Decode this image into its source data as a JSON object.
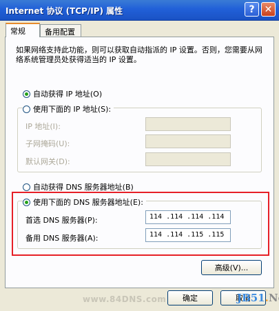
{
  "window": {
    "title": "Internet 协议 (TCP/IP) 属性",
    "help_glyph": "?",
    "close_glyph": "✕"
  },
  "tabs": [
    {
      "label": "常规",
      "active": true
    },
    {
      "label": "备用配置",
      "active": false
    }
  ],
  "intro": "如果网络支持此功能，则可以获取自动指派的 IP 设置。否则，您需要从网络系统管理员处获得适当的 IP 设置。",
  "ip": {
    "auto_label": "自动获得 IP 地址(O)",
    "manual_label": "使用下面的 IP 地址(S):",
    "fields": [
      {
        "label": "IP 地址(I):",
        "value": ""
      },
      {
        "label": "子网掩码(U):",
        "value": ""
      },
      {
        "label": "默认网关(D):",
        "value": ""
      }
    ]
  },
  "dns": {
    "auto_label": "自动获得 DNS 服务器地址(B)",
    "manual_label": "使用下面的 DNS 服务器地址(E):",
    "preferred_label": "首选 DNS 服务器(P):",
    "preferred_value": "114 .114 .114 .114",
    "alternate_label": "备用 DNS 服务器(A):",
    "alternate_value": "114 .114 .115 .115"
  },
  "buttons": {
    "advanced": "高级(V)...",
    "ok": "确定",
    "cancel": "取消"
  },
  "watermark": "www.84DNS.com",
  "logo": {
    "part1": "JB51",
    "part2": ".",
    "part3": "Net"
  },
  "colors": {
    "highlight": "#e61f26",
    "radio_dot": "#22a018",
    "title_bar": "#2160d8"
  }
}
